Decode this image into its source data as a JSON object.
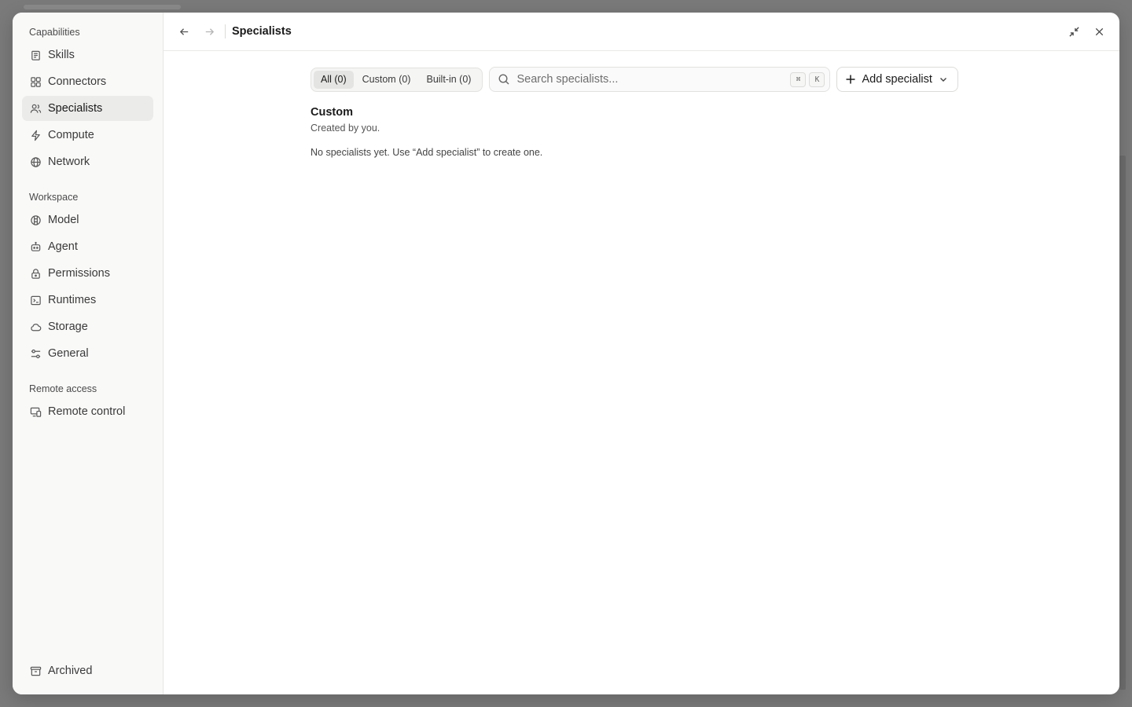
{
  "sidebar": {
    "sections": [
      {
        "label": "Capabilities",
        "items": [
          {
            "label": "Skills",
            "icon": "skills-icon"
          },
          {
            "label": "Connectors",
            "icon": "connectors-icon"
          },
          {
            "label": "Specialists",
            "icon": "users-icon",
            "active": true
          },
          {
            "label": "Compute",
            "icon": "lightning-icon"
          },
          {
            "label": "Network",
            "icon": "globe-icon"
          }
        ]
      },
      {
        "label": "Workspace",
        "items": [
          {
            "label": "Model",
            "icon": "model-icon"
          },
          {
            "label": "Agent",
            "icon": "robot-icon"
          },
          {
            "label": "Permissions",
            "icon": "lock-icon"
          },
          {
            "label": "Runtimes",
            "icon": "terminal-icon"
          },
          {
            "label": "Storage",
            "icon": "cloud-icon"
          },
          {
            "label": "General",
            "icon": "sliders-icon"
          }
        ]
      },
      {
        "label": "Remote access",
        "items": [
          {
            "label": "Remote control",
            "icon": "remote-control-icon"
          }
        ]
      }
    ],
    "bottom_item": {
      "label": "Archived",
      "icon": "archive-icon"
    }
  },
  "topbar": {
    "title": "Specialists"
  },
  "filters": {
    "tabs": [
      {
        "label": "All (0)",
        "active": true
      },
      {
        "label": "Custom (0)",
        "active": false
      },
      {
        "label": "Built-in (0)",
        "active": false
      }
    ]
  },
  "search": {
    "placeholder": "Search specialists...",
    "shortcut_keys": [
      "⌘",
      "K"
    ]
  },
  "add_button": {
    "label": "Add specialist"
  },
  "group": {
    "title": "Custom",
    "subtitle": "Created by you.",
    "empty_message": "No specialists yet. Use “Add specialist” to create one."
  },
  "colors": {
    "sidebar_bg": "#f9f9f8",
    "active_item_bg": "#ebebea",
    "backdrop": "#7a7a7a"
  }
}
